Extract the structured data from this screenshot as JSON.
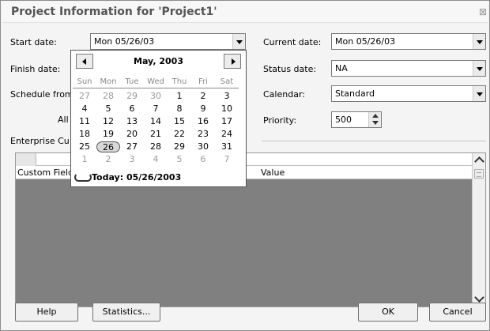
{
  "title": "Project Information for 'Project1'",
  "fields": {
    "start_date_label": "Start date:",
    "start_date_value": "Mon 05/26/03",
    "finish_date_label": "Finish date:",
    "schedule_from_label": "Schedule from:",
    "all_label": "All t",
    "enterprise_label": "Enterprise Cu",
    "current_date_label": "Current date:",
    "current_date_value": "Mon 05/26/03",
    "status_date_label": "Status date:",
    "status_date_value": "NA",
    "calendar_label": "Calendar:",
    "calendar_value": "Standard",
    "priority_label": "Priority:",
    "priority_value": "500"
  },
  "grid": {
    "col_custom_field": "Custom Field",
    "col_value": "Value"
  },
  "calendar_popup": {
    "month_title": "May, 2003",
    "weekdays": [
      "Sun",
      "Mon",
      "Tue",
      "Wed",
      "Thu",
      "Fri",
      "Sat"
    ],
    "weeks": [
      [
        {
          "d": "27",
          "m": true
        },
        {
          "d": "28",
          "m": true
        },
        {
          "d": "29",
          "m": true
        },
        {
          "d": "30",
          "m": true
        },
        {
          "d": "1"
        },
        {
          "d": "2"
        },
        {
          "d": "3"
        }
      ],
      [
        {
          "d": "4"
        },
        {
          "d": "5"
        },
        {
          "d": "6"
        },
        {
          "d": "7"
        },
        {
          "d": "8"
        },
        {
          "d": "9"
        },
        {
          "d": "10"
        }
      ],
      [
        {
          "d": "11"
        },
        {
          "d": "12"
        },
        {
          "d": "13"
        },
        {
          "d": "14"
        },
        {
          "d": "15"
        },
        {
          "d": "16"
        },
        {
          "d": "17"
        }
      ],
      [
        {
          "d": "18"
        },
        {
          "d": "19"
        },
        {
          "d": "20"
        },
        {
          "d": "21"
        },
        {
          "d": "22"
        },
        {
          "d": "23"
        },
        {
          "d": "24"
        }
      ],
      [
        {
          "d": "25"
        },
        {
          "d": "26",
          "sel": true
        },
        {
          "d": "27"
        },
        {
          "d": "28"
        },
        {
          "d": "29"
        },
        {
          "d": "30"
        },
        {
          "d": "31"
        }
      ],
      [
        {
          "d": "1",
          "m": true
        },
        {
          "d": "2",
          "m": true
        },
        {
          "d": "3",
          "m": true
        },
        {
          "d": "4",
          "m": true
        },
        {
          "d": "5",
          "m": true
        },
        {
          "d": "6",
          "m": true
        },
        {
          "d": "7",
          "m": true
        }
      ]
    ],
    "today_text": "Today: 05/26/2003"
  },
  "buttons": {
    "help": "Help",
    "statistics": "Statistics...",
    "ok": "OK",
    "cancel": "Cancel"
  }
}
